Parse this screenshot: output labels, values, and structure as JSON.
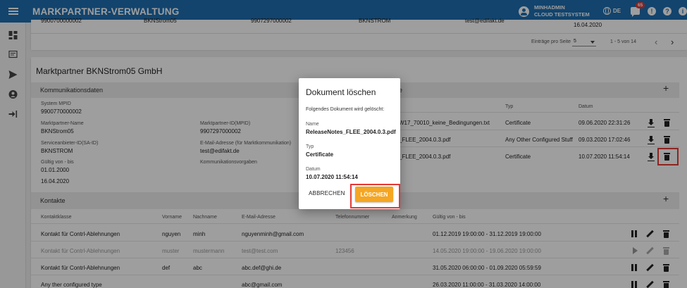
{
  "app": {
    "title": "MARKPARTNER-VERWALTUNG"
  },
  "user": {
    "name": "MINHADMIN",
    "system": "CLOUD TESTSYSTEM"
  },
  "header": {
    "language": "DE",
    "notifications_count": "65",
    "alert_glyph": "!",
    "help_glyph": "?",
    "info_glyph": "i"
  },
  "top_table": {
    "row": [
      "9900700000002",
      "BKNStrom05",
      "9907297000002",
      "BKNSTROM",
      "test@edifakt.de",
      "16.04.2020"
    ],
    "entries_label": "Einträge pro Seite",
    "entries_value": "5",
    "range": "1 - 5 von 14"
  },
  "partner": {
    "name": "Marktpartner BKNStrom05 GmbH",
    "section_title": "Kommunikationsdaten",
    "fields": {
      "system_mpid_label": "System MPID",
      "system_mpid": "9900770000002",
      "name_label": "Marktpartner-Name",
      "name": "BKNStrom05",
      "mpid_label": "Marktpartner-ID(MPID)",
      "mpid": "9907297000002",
      "said_label": "Serviceanbieter-ID(SA-ID)",
      "said": "BKNSTROM",
      "email_label": "E-Mail-Adresse (für Marktkommunikation)",
      "email": "test@edifakt.de",
      "validity_label": "Gültig von - bis",
      "valid_from": "01.01.2000",
      "valid_to": "16.04.2020",
      "comm_label": "Kommunikationsvorgaben"
    }
  },
  "documents": {
    "header_partial": "e",
    "col_type": "Typ",
    "col_date": "Datum",
    "rows": [
      {
        "name": "W17_70010_keine_Bedingungen.txt",
        "type": "Certificate",
        "date": "09.06.2020 22:31:26"
      },
      {
        "name": "_FLEE_2004.0.3.pdf",
        "type": "Any Other Configured Stuff",
        "date": "09.03.2020 17:02:46"
      },
      {
        "name": "_FLEE_2004.0.3.pdf",
        "type": "Certificate",
        "date": "10.07.2020 11:54:14"
      }
    ]
  },
  "contacts": {
    "section_title": "Kontakte",
    "headers": [
      "Kontaktklasse",
      "Vorname",
      "Nachname",
      "E-Mail-Adresse",
      "Telefonnummer",
      "Anmerkung",
      "Gültig von - bis"
    ],
    "rows": [
      {
        "klasse": "Kontakt für Contrl-Ablehnungen",
        "vorname": "nguyen",
        "nachname": "minh",
        "email": "nguyenminh@gmail.com",
        "telefon": "",
        "anmerkung": "",
        "gueltig": "01.12.2019 19:00:00 - 31.12.2019 19:00:00"
      },
      {
        "klasse": "Kontakt für Contrl-Ablehnungen",
        "vorname": "muster",
        "nachname": "mustermann",
        "email": "test@test.com",
        "telefon": "123456",
        "anmerkung": "",
        "gueltig": "14.05.2020 19:00:00 - 19.06.2020 19:00:00"
      },
      {
        "klasse": "Kontakt für Contrl-Ablehnungen",
        "vorname": "def",
        "nachname": "abc",
        "email": "abc.def@ghi.de",
        "telefon": "",
        "anmerkung": "",
        "gueltig": "31.05.2020 06:00:00 - 01.09.2020 05:59:59"
      },
      {
        "klasse": "Any ther configured type",
        "vorname": "",
        "nachname": "",
        "email": "abc@gmail.com",
        "telefon": "",
        "anmerkung": "",
        "gueltig": "26.03.2020 11:00:00 - 31.03.2020 14:00:00"
      }
    ]
  },
  "dialog": {
    "title": "Dokument löschen",
    "description": "Folgendes Dokument wird gelöscht:",
    "name_label": "Name",
    "name_value": "ReleaseNotes_FLEE_2004.0.3.pdf",
    "type_label": "Typ",
    "type_value": "Certificate",
    "date_label": "Datum",
    "date_value": "10.07.2020 11:54:14",
    "cancel_label": "ABBRECHEN",
    "delete_label": "LÖSCHEN"
  },
  "colors": {
    "primary": "#1d6fb0",
    "accent": "#f5a623",
    "highlight": "#e53935"
  },
  "icons": [
    "menu-icon",
    "account-icon",
    "globe-icon",
    "chat-icon",
    "alert-icon",
    "help-icon",
    "info-icon",
    "dashboard-icon",
    "message-icon",
    "send-icon",
    "account-circle-icon",
    "login-icon",
    "download-icon",
    "trash-icon",
    "pause-icon",
    "play-icon",
    "edit-icon",
    "plus-icon"
  ]
}
